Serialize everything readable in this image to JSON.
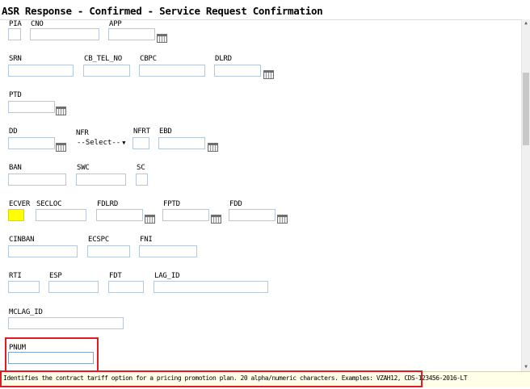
{
  "window": {
    "title": "ASR Response - Confirmed - Service Request Confirmation"
  },
  "fields": {
    "pia": "PIA",
    "cno": "CNO",
    "app": "APP",
    "srn": "SRN",
    "cb_tel_no": "CB_TEL_NO",
    "cbpc": "CBPC",
    "dlrd": "DLRD",
    "ptd": "PTD",
    "dd": "DD",
    "nfr": "NFR",
    "nfrt": "NFRT",
    "ebd": "EBD",
    "ban": "BAN",
    "swc": "SWC",
    "sc": "SC",
    "ecver": "ECVER",
    "secloc": "SECLOC",
    "fdlrd": "FDLRD",
    "fptd": "FPTD",
    "fdd": "FDD",
    "cinban": "CINBAN",
    "ecspc": "ECSPC",
    "fni": "FNI",
    "rti": "RTI",
    "esp": "ESP",
    "fdt": "FDT",
    "lag_id": "LAG_ID",
    "mclag_id": "MCLAG_ID",
    "pnum": "PNUM"
  },
  "nfr_select": {
    "value": "--Select--"
  },
  "colors": {
    "highlight": "#ffff00",
    "annotation": "#e01b24",
    "input_border": "#b5c7d8"
  },
  "hint": {
    "text": "Identifies the contract tariff option for a pricing promotion plan. 20 alpha/numeric characters. Examples: VZAH12, CDS-123456-2016-LT"
  }
}
